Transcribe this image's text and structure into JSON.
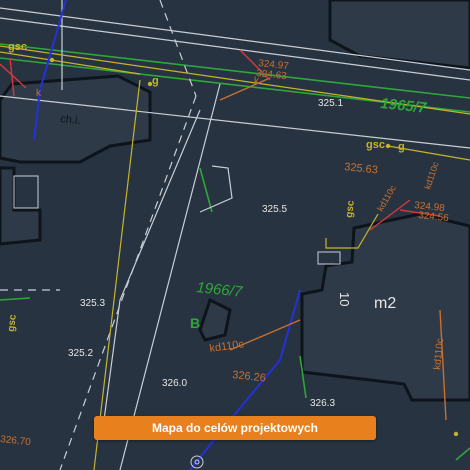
{
  "map": {
    "colors": {
      "background": "#273341",
      "building_outline": "#0d141c",
      "building_fill": "#2e3a48",
      "boundary_white": "#c9ced6",
      "parcel_green": "#2fa63a",
      "gas_yellow": "#c7b42a",
      "water_blue": "#2430d8",
      "sewer_orange": "#c8702e",
      "utility_red": "#d23a3a",
      "label_white": "#e6e6e6"
    },
    "labels": {
      "parcel_1965": "1965/7",
      "parcel_1966": "1966/7",
      "letter_b": "B",
      "building_m2": "m2",
      "building_ch": "ch.i.",
      "storeys": "10",
      "gsc_top_left": "gsc",
      "gsc_mid": "gsc",
      "gsc_vertical": "gsc",
      "gsc_left": "gsc",
      "g_top": "g",
      "g_right": "g",
      "k_1": "k",
      "k_2": "k",
      "kd110c": "kd110c",
      "kd_vertical": "kd110c",
      "kd_right_top": "kd110c",
      "kd_diag": "kd110c",
      "elev_324_97": "324.97",
      "elev_324_63": "324.63",
      "elev_325_1": "325.1",
      "elev_325_63": "325.63",
      "elev_324_98": "324.98",
      "elev_324_56": "324.56",
      "elev_325_5": "325.5",
      "elev_325_3": "325.3",
      "elev_325_2": "325.2",
      "elev_326_26": "326.26",
      "elev_326_0": "326.0",
      "elev_326_3": "326.3",
      "elev_326_70": "326.70"
    }
  },
  "banner": {
    "label": "Mapa do celów projektowych",
    "color": "#e8801e"
  }
}
